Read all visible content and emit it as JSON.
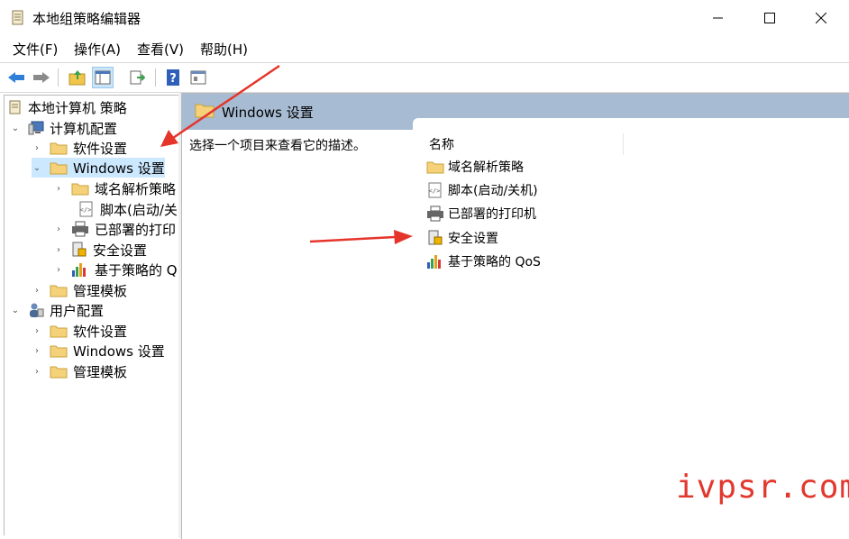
{
  "window": {
    "title": "本地组策略编辑器"
  },
  "menu": [
    "文件(F)",
    "操作(A)",
    "查看(V)",
    "帮助(H)"
  ],
  "toolbar": {
    "buttons": [
      "back-icon",
      "forward-icon",
      "up-folder-icon",
      "show-hide-tree-icon",
      "export-list-icon",
      "help-icon",
      "properties-icon"
    ]
  },
  "tree": {
    "root": "本地计算机 策略",
    "computer": "计算机配置",
    "c_software": "软件设置",
    "c_windows": "Windows 设置",
    "c_dns": "域名解析策略",
    "c_scripts": "脚本(启动/关",
    "c_printers": "已部署的打印",
    "c_security": "安全设置",
    "c_qos": "基于策略的 Q",
    "c_admin": "管理模板",
    "user": "用户配置",
    "u_software": "软件设置",
    "u_windows": "Windows 设置",
    "u_admin": "管理模板"
  },
  "right": {
    "header": "Windows 设置",
    "description": "选择一个项目来查看它的描述。",
    "column_name": "名称",
    "items": [
      "域名解析策略",
      "脚本(启动/关机)",
      "已部署的打印机",
      "安全设置",
      "基于策略的 QoS"
    ]
  },
  "watermark": "ivpsr.com",
  "colors": {
    "header_bg": "#a7bbd3",
    "selected_bg": "#cce8ff",
    "arrow": "#e5352b"
  }
}
